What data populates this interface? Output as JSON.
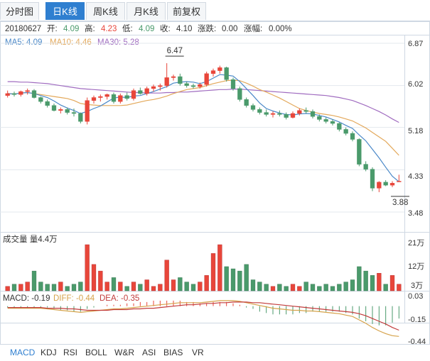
{
  "tabs": [
    {
      "label": "分时图",
      "active": false
    },
    {
      "label": "日K线",
      "active": true
    },
    {
      "label": "周K线",
      "active": false
    },
    {
      "label": "月K线",
      "active": false
    },
    {
      "label": "前复权",
      "active": false
    }
  ],
  "info_bar": {
    "date": "20180627",
    "open_label": "开:",
    "open": "4.09",
    "high_label": "高:",
    "high": "4.23",
    "low_label": "低:",
    "low": "4.09",
    "close_label": "收:",
    "close": "4.10",
    "change_label": "涨跌:",
    "change": "0.00",
    "pct_label": "涨幅:",
    "pct": "0.00%"
  },
  "ma_legend": {
    "ma5": "MA5: 4.09",
    "ma10": "MA10: 4.46",
    "ma30": "MA30: 5.28"
  },
  "volume_legend": "成交量 量4.4万",
  "macd_legend": {
    "macd": "MACD: -0.19",
    "diff": "DIFF: -0.44",
    "dea": "DEA: -0.35"
  },
  "bottom_tabs": [
    {
      "label": "MACD",
      "active": true
    },
    {
      "label": "KDJ",
      "active": false
    },
    {
      "label": "RSI",
      "active": false
    },
    {
      "label": "BOLL",
      "active": false
    },
    {
      "label": "W&R",
      "active": false
    },
    {
      "label": "ASI",
      "active": false
    },
    {
      "label": "BIAS",
      "active": false
    },
    {
      "label": "VR",
      "active": false
    }
  ],
  "colors": {
    "up": "#e8463a",
    "down": "#4a9a6b",
    "ma5": "#4a88c8",
    "ma10": "#e3a85a",
    "ma30": "#a06cc0",
    "diff": "#d6a24a",
    "dea": "#c23b3b",
    "grid": "#e3e8ee"
  },
  "chart_data": [
    {
      "type": "candlestick",
      "y_ticks": [
        "6.87",
        "6.02",
        "5.18",
        "4.33",
        "3.48"
      ],
      "ylim": [
        3.48,
        6.87
      ],
      "annotations": [
        {
          "label": "6.47",
          "index": 24,
          "value": 6.47
        },
        {
          "label": "3.88",
          "index": 58,
          "value": 3.88
        }
      ],
      "ohlc": [
        [
          5.82,
          5.92,
          5.78,
          5.86
        ],
        [
          5.86,
          5.9,
          5.8,
          5.84
        ],
        [
          5.84,
          5.92,
          5.8,
          5.9
        ],
        [
          5.9,
          5.96,
          5.84,
          5.92
        ],
        [
          5.92,
          5.95,
          5.76,
          5.78
        ],
        [
          5.78,
          5.8,
          5.66,
          5.7
        ],
        [
          5.7,
          5.74,
          5.58,
          5.62
        ],
        [
          5.62,
          5.66,
          5.5,
          5.52
        ],
        [
          5.52,
          5.58,
          5.46,
          5.54
        ],
        [
          5.54,
          5.58,
          5.44,
          5.48
        ],
        [
          5.48,
          5.56,
          5.4,
          5.46
        ],
        [
          5.46,
          5.48,
          5.26,
          5.3
        ],
        [
          5.3,
          5.78,
          5.24,
          5.72
        ],
        [
          5.72,
          5.82,
          5.66,
          5.78
        ],
        [
          5.78,
          5.84,
          5.7,
          5.8
        ],
        [
          5.8,
          5.86,
          5.74,
          5.84
        ],
        [
          5.84,
          5.88,
          5.66,
          5.7
        ],
        [
          5.7,
          5.86,
          5.66,
          5.82
        ],
        [
          5.82,
          5.88,
          5.72,
          5.76
        ],
        [
          5.76,
          5.96,
          5.72,
          5.92
        ],
        [
          5.92,
          5.98,
          5.84,
          5.86
        ],
        [
          5.86,
          6.0,
          5.82,
          5.96
        ],
        [
          5.96,
          6.04,
          5.9,
          6.0
        ],
        [
          6.0,
          6.06,
          5.92,
          6.02
        ],
        [
          6.02,
          6.47,
          5.98,
          6.18
        ],
        [
          6.18,
          6.24,
          6.12,
          6.2
        ],
        [
          6.2,
          6.26,
          6.02,
          6.06
        ],
        [
          6.06,
          6.1,
          5.98,
          6.02
        ],
        [
          6.02,
          6.06,
          5.96,
          6.0
        ],
        [
          6.0,
          6.08,
          5.96,
          6.04
        ],
        [
          6.04,
          6.3,
          6.0,
          6.26
        ],
        [
          6.26,
          6.36,
          6.2,
          6.32
        ],
        [
          6.32,
          6.42,
          6.26,
          6.38
        ],
        [
          6.38,
          6.4,
          6.1,
          6.14
        ],
        [
          6.14,
          6.18,
          5.92,
          5.96
        ],
        [
          5.96,
          6.0,
          5.7,
          5.74
        ],
        [
          5.74,
          5.78,
          5.58,
          5.62
        ],
        [
          5.62,
          5.66,
          5.5,
          5.54
        ],
        [
          5.54,
          5.58,
          5.44,
          5.48
        ],
        [
          5.48,
          5.54,
          5.4,
          5.44
        ],
        [
          5.44,
          5.5,
          5.38,
          5.46
        ],
        [
          5.46,
          5.52,
          5.4,
          5.44
        ],
        [
          5.44,
          5.48,
          5.34,
          5.38
        ],
        [
          5.38,
          5.5,
          5.36,
          5.46
        ],
        [
          5.46,
          5.56,
          5.42,
          5.52
        ],
        [
          5.52,
          5.58,
          5.46,
          5.5
        ],
        [
          5.5,
          5.54,
          5.36,
          5.4
        ],
        [
          5.4,
          5.44,
          5.3,
          5.34
        ],
        [
          5.34,
          5.38,
          5.26,
          5.3
        ],
        [
          5.3,
          5.34,
          5.22,
          5.26
        ],
        [
          5.26,
          5.28,
          5.1,
          5.14
        ],
        [
          5.14,
          5.18,
          5.02,
          5.06
        ],
        [
          5.06,
          5.1,
          4.9,
          4.94
        ],
        [
          4.94,
          4.96,
          4.4,
          4.44
        ],
        [
          4.44,
          4.5,
          4.3,
          4.34
        ],
        [
          4.34,
          4.38,
          3.9,
          3.96
        ],
        [
          3.96,
          4.1,
          3.88,
          4.08
        ],
        [
          4.08,
          4.12,
          4.0,
          4.02
        ],
        [
          4.02,
          4.1,
          3.98,
          4.06
        ],
        [
          4.09,
          4.23,
          4.09,
          4.1
        ]
      ],
      "ma5": [
        5.86,
        5.85,
        5.87,
        5.88,
        5.86,
        5.82,
        5.78,
        5.71,
        5.63,
        5.57,
        5.52,
        5.46,
        5.5,
        5.56,
        5.61,
        5.69,
        5.77,
        5.79,
        5.78,
        5.81,
        5.82,
        5.86,
        5.9,
        5.95,
        6.0,
        6.07,
        6.09,
        6.1,
        6.09,
        6.06,
        6.1,
        6.17,
        6.24,
        6.23,
        6.21,
        6.1,
        5.96,
        5.82,
        5.67,
        5.56,
        5.51,
        5.47,
        5.44,
        5.43,
        5.45,
        5.46,
        5.45,
        5.42,
        5.39,
        5.34,
        5.29,
        5.22,
        5.16,
        5.03,
        4.91,
        4.74,
        4.57,
        4.38,
        4.2,
        4.09
      ],
      "ma10": [
        5.86,
        5.85,
        5.87,
        5.88,
        5.86,
        5.84,
        5.82,
        5.8,
        5.78,
        5.76,
        5.72,
        5.66,
        5.64,
        5.63,
        5.62,
        5.62,
        5.62,
        5.62,
        5.63,
        5.66,
        5.69,
        5.72,
        5.74,
        5.77,
        5.81,
        5.86,
        5.9,
        5.94,
        5.96,
        5.98,
        6.02,
        6.06,
        6.09,
        6.12,
        6.13,
        6.12,
        6.07,
        6.01,
        5.94,
        5.89,
        5.83,
        5.77,
        5.7,
        5.63,
        5.56,
        5.52,
        5.49,
        5.46,
        5.44,
        5.42,
        5.39,
        5.35,
        5.31,
        5.24,
        5.17,
        5.08,
        4.99,
        4.9,
        4.76,
        4.62
      ],
      "ma30": [
        6.1,
        6.1,
        6.09,
        6.09,
        6.08,
        6.07,
        6.06,
        6.04,
        6.02,
        6.0,
        5.98,
        5.96,
        5.95,
        5.94,
        5.93,
        5.92,
        5.91,
        5.9,
        5.89,
        5.88,
        5.88,
        5.87,
        5.87,
        5.87,
        5.88,
        5.88,
        5.89,
        5.89,
        5.9,
        5.91,
        5.92,
        5.93,
        5.94,
        5.94,
        5.95,
        5.95,
        5.94,
        5.93,
        5.92,
        5.91,
        5.9,
        5.89,
        5.88,
        5.87,
        5.86,
        5.85,
        5.84,
        5.83,
        5.82,
        5.8,
        5.78,
        5.75,
        5.72,
        5.67,
        5.62,
        5.56,
        5.5,
        5.43,
        5.35,
        5.28
      ]
    },
    {
      "type": "bar",
      "y_ticks": [
        "21万",
        "12万",
        "3万"
      ],
      "ylim": [
        0,
        21
      ],
      "values": [
        2,
        3,
        3,
        4,
        9,
        4,
        3,
        3,
        4,
        2,
        3,
        4,
        21,
        12,
        9,
        4,
        6,
        4,
        2,
        4,
        3,
        5,
        2,
        3,
        14,
        5,
        6,
        4,
        3,
        4,
        7,
        17,
        21,
        11,
        10,
        9,
        12,
        5,
        4,
        3,
        2,
        3,
        2,
        3,
        2,
        4,
        3,
        2,
        3,
        2,
        3,
        4,
        5,
        11,
        9,
        7,
        8,
        3,
        7,
        3
      ]
    },
    {
      "type": "line",
      "y_ticks": [
        "0.03",
        "-0.15",
        "-0.44"
      ],
      "ylim": [
        -0.52,
        0.1
      ],
      "diff": [
        -0.03,
        -0.03,
        -0.03,
        -0.03,
        -0.03,
        -0.03,
        -0.04,
        -0.05,
        -0.06,
        -0.07,
        -0.08,
        -0.09,
        -0.08,
        -0.07,
        -0.06,
        -0.05,
        -0.04,
        -0.04,
        -0.03,
        -0.02,
        -0.01,
        0.0,
        0.01,
        0.02,
        0.03,
        0.04,
        0.05,
        0.05,
        0.05,
        0.05,
        0.06,
        0.07,
        0.08,
        0.08,
        0.08,
        0.07,
        0.05,
        0.03,
        0.01,
        -0.01,
        -0.03,
        -0.04,
        -0.05,
        -0.06,
        -0.06,
        -0.07,
        -0.07,
        -0.08,
        -0.09,
        -0.1,
        -0.11,
        -0.13,
        -0.15,
        -0.2,
        -0.25,
        -0.31,
        -0.36,
        -0.4,
        -0.43,
        -0.44
      ],
      "dea": [
        -0.02,
        -0.02,
        -0.02,
        -0.02,
        -0.02,
        -0.02,
        -0.03,
        -0.03,
        -0.03,
        -0.04,
        -0.04,
        -0.05,
        -0.06,
        -0.06,
        -0.06,
        -0.06,
        -0.05,
        -0.05,
        -0.05,
        -0.04,
        -0.04,
        -0.03,
        -0.03,
        -0.02,
        -0.01,
        0.0,
        0.01,
        0.02,
        0.02,
        0.03,
        0.04,
        0.04,
        0.05,
        0.05,
        0.06,
        0.06,
        0.06,
        0.05,
        0.05,
        0.04,
        0.03,
        0.02,
        0.01,
        0.0,
        -0.01,
        -0.02,
        -0.03,
        -0.04,
        -0.05,
        -0.06,
        -0.07,
        -0.08,
        -0.09,
        -0.11,
        -0.14,
        -0.18,
        -0.22,
        -0.26,
        -0.31,
        -0.35
      ]
    }
  ]
}
